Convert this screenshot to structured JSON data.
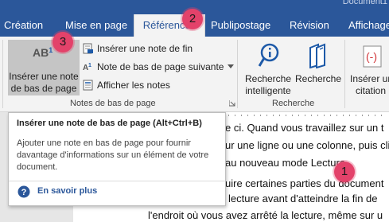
{
  "window": {
    "doc_title": "Document1"
  },
  "tabs": [
    {
      "label": "Création"
    },
    {
      "label": "Mise en page"
    },
    {
      "label": "Références"
    },
    {
      "label": "Publipostage"
    },
    {
      "label": "Révision"
    },
    {
      "label": "Affichage"
    }
  ],
  "ribbon": {
    "notes_group": {
      "big_button_line1": "Insérer une note",
      "big_button_line2": "de bas de page",
      "big_button_icon_text": "AB",
      "big_button_icon_sup": "1",
      "insert_endnote": "Insérer une note de fin",
      "next_footnote": "Note de bas de page suivante",
      "show_notes": "Afficher les notes",
      "label": "Notes de bas de page"
    },
    "research_group": {
      "smart_lookup_line1": "Recherche",
      "smart_lookup_line2": "intelligente",
      "researcher": "Recherche",
      "label": "Recherche"
    },
    "citations_group": {
      "insert_citation_line1": "Insérer une",
      "insert_citation_line2": "citation"
    }
  },
  "markers": {
    "m1": "1",
    "m2": "2",
    "m3": "3"
  },
  "tooltip": {
    "title": "Insérer une note de bas de page (Alt+Ctrl+B)",
    "body": "Ajouter une note en bas de page pour fournir davantage d'informations sur un élément de votre document.",
    "link": "En savoir plus"
  },
  "document": {
    "lines": [
      "e ci. Quand vous travaillez sur un t",
      "ur une ligne ou une colonne, puis cli",
      "au nouveau mode Lecture.",
      "uire certaines parties du document",
      "lecture avant d'atteindre la fin de",
      "l'endroit où vous avez arrêté la lecture, même sur u"
    ]
  },
  "colors": {
    "ribbon_blue": "#2b579a",
    "marker_pink": "#e3426a"
  }
}
